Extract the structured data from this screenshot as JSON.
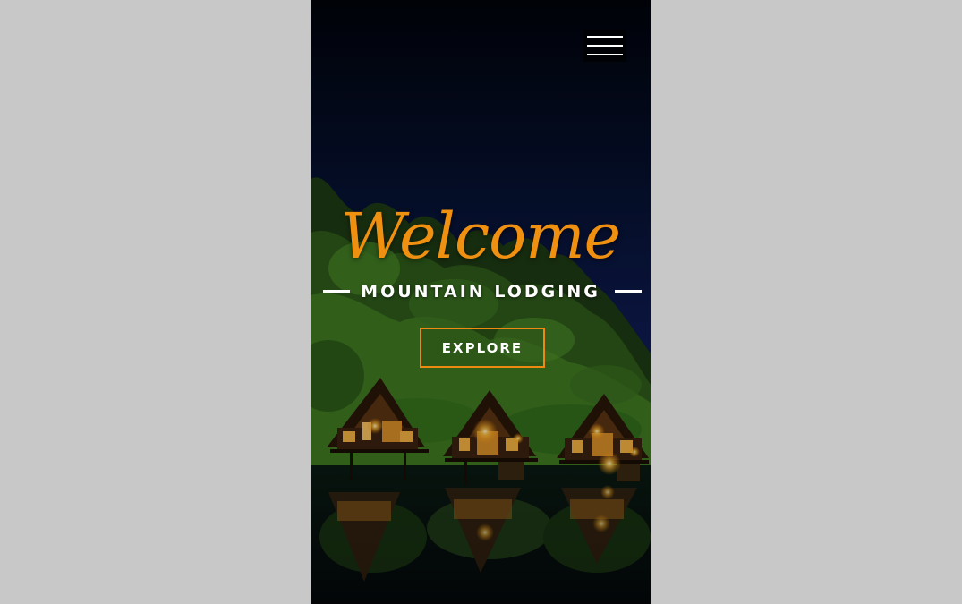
{
  "nav": {
    "menu_icon": "hamburger-menu-icon"
  },
  "hero": {
    "welcome": "Welcome",
    "subtitle": "MOUNTAIN LODGING",
    "cta_label": "EXPLORE",
    "background_image": "night-lake-treehouse-cabins"
  },
  "colors": {
    "accent": "#f09010",
    "button_border": "#ee8a12",
    "text": "#ffffff",
    "page_bg": "#c8c8c8"
  }
}
